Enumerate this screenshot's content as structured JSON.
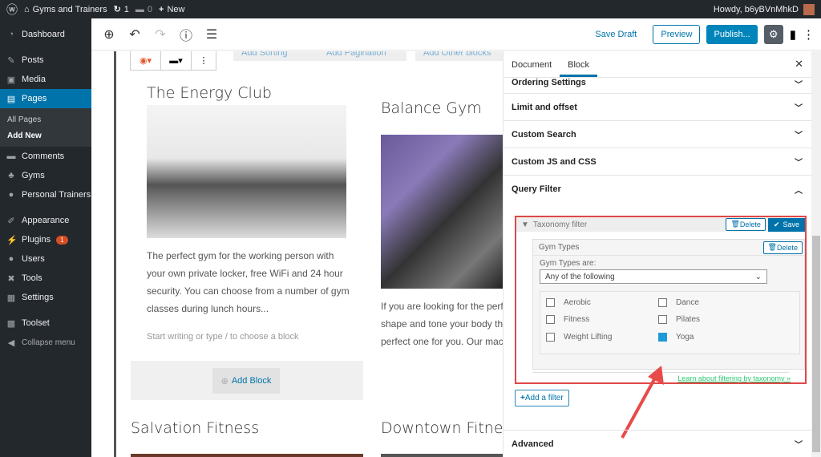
{
  "admin_bar": {
    "site": "Gyms and Trainers",
    "updates": "1",
    "comments": "0",
    "new": "New",
    "howdy": "Howdy, b6yBVnMhkD"
  },
  "sidebar": {
    "items": [
      {
        "icon": "dashboard-icon",
        "glyph": "◔",
        "label": "Dashboard"
      },
      {
        "icon": "pin-icon",
        "glyph": "✎",
        "label": "Posts"
      },
      {
        "icon": "media-icon",
        "glyph": "▣",
        "label": "Media"
      },
      {
        "icon": "pages-icon",
        "glyph": "▤",
        "label": "Pages"
      },
      {
        "icon": "comments-icon",
        "glyph": "▬",
        "label": "Comments"
      },
      {
        "icon": "gyms-icon",
        "glyph": "♣",
        "label": "Gyms"
      },
      {
        "icon": "trainers-icon",
        "glyph": "●",
        "label": "Personal Trainers"
      },
      {
        "icon": "appearance-icon",
        "glyph": "✐",
        "label": "Appearance"
      },
      {
        "icon": "plugins-icon",
        "glyph": "⚡",
        "label": "Plugins",
        "badge": "1"
      },
      {
        "icon": "users-icon",
        "glyph": "●",
        "label": "Users"
      },
      {
        "icon": "tools-icon",
        "glyph": "✖",
        "label": "Tools"
      },
      {
        "icon": "settings-icon",
        "glyph": "▦",
        "label": "Settings"
      },
      {
        "icon": "toolset-icon",
        "glyph": "▩",
        "label": "Toolset"
      },
      {
        "icon": "collapse-icon",
        "glyph": "◀",
        "label": "Collapse menu"
      }
    ],
    "sub": [
      "All Pages",
      "Add New"
    ]
  },
  "editor_header": {
    "save_draft": "Save Draft",
    "preview": "Preview",
    "publish": "Publish..."
  },
  "canvas": {
    "ghost_buttons": [
      "Add Sorting",
      "Add Pagination",
      "Add Other blocks"
    ],
    "cards": [
      {
        "title": "The Energy Club",
        "text": [
          "The perfect gym for the working person with",
          "your own private locker, free WiFi and 24 hour",
          "security. You can choose from a number of gym",
          "classes during lunch hours..."
        ]
      },
      {
        "title": "Balance Gym",
        "text": [
          "If you are looking for the perfe",
          "shape and tone your body the",
          "perfect one for you. Our mach"
        ]
      },
      {
        "title": "Salvation Fitness"
      },
      {
        "title": "Downtown Fitness C"
      }
    ],
    "placeholder": "Start writing or type / to choose a block",
    "add_block": "Add Block"
  },
  "panel": {
    "tabs": [
      "Document",
      "Block"
    ],
    "active_tab": "Block",
    "sections": [
      "Ordering Settings",
      "Limit and offset",
      "Custom Search",
      "Custom JS and CSS",
      "Query Filter"
    ],
    "taxonomy_filter": {
      "title": "Taxonomy filter",
      "delete": "Delete",
      "save": "Save",
      "group": {
        "title": "Gym Types",
        "delete": "Delete",
        "label": "Gym Types are:",
        "select": "Any of the following",
        "options": [
          {
            "label": "Aerobic",
            "checked": false
          },
          {
            "label": "Dance",
            "checked": false
          },
          {
            "label": "Fitness",
            "checked": false
          },
          {
            "label": "Pilates",
            "checked": false
          },
          {
            "label": "Weight Lifting",
            "checked": false
          },
          {
            "label": "Yoga",
            "checked": true
          }
        ]
      },
      "learn": "Learn about filtering by taxonomy »"
    },
    "add_filter": "Add a filter",
    "advanced": "Advanced"
  },
  "colors": {
    "accent": "#0073aa",
    "highlight": "#e04848",
    "link_green": "#2ecc71"
  }
}
